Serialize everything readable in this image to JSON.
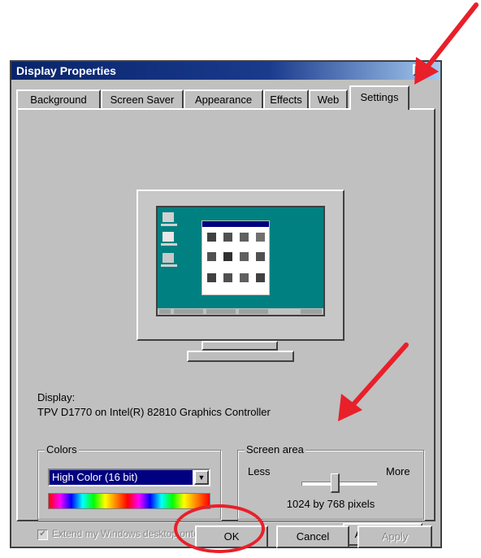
{
  "window": {
    "title": "Display Properties",
    "help_button": "?",
    "close_button": "×"
  },
  "tabs": [
    {
      "label": "Background",
      "active": false
    },
    {
      "label": "Screen Saver",
      "active": false
    },
    {
      "label": "Appearance",
      "active": false
    },
    {
      "label": "Effects",
      "active": false
    },
    {
      "label": "Web",
      "active": false
    },
    {
      "label": "Settings",
      "active": true
    }
  ],
  "display": {
    "heading": "Display:",
    "device": "TPV D1770 on Intel(R) 82810 Graphics Controller"
  },
  "colors": {
    "group_title": "Colors",
    "selected_value": "High Color (16 bit)"
  },
  "screen_area": {
    "group_title": "Screen area",
    "less_label": "Less",
    "more_label": "More",
    "resolution_text": "1024 by 768 pixels",
    "slider_fraction": 0.45
  },
  "extend_checkbox": {
    "label": "Extend my Windows desktop onto this monitor.",
    "checked": true,
    "enabled": false
  },
  "buttons": {
    "advanced": "Advanced...",
    "ok": "OK",
    "cancel": "Cancel",
    "apply": "Apply"
  },
  "colors_palette": {
    "window_bg": "#c0c0c0",
    "title_bar": "#08246b",
    "desktop": "#008080",
    "selection": "#000080",
    "annotation": "#e8202a"
  },
  "icons": [
    "help-icon",
    "close-icon",
    "dropdown-arrow-icon",
    "checkbox-check-icon",
    "monitor-icon"
  ]
}
